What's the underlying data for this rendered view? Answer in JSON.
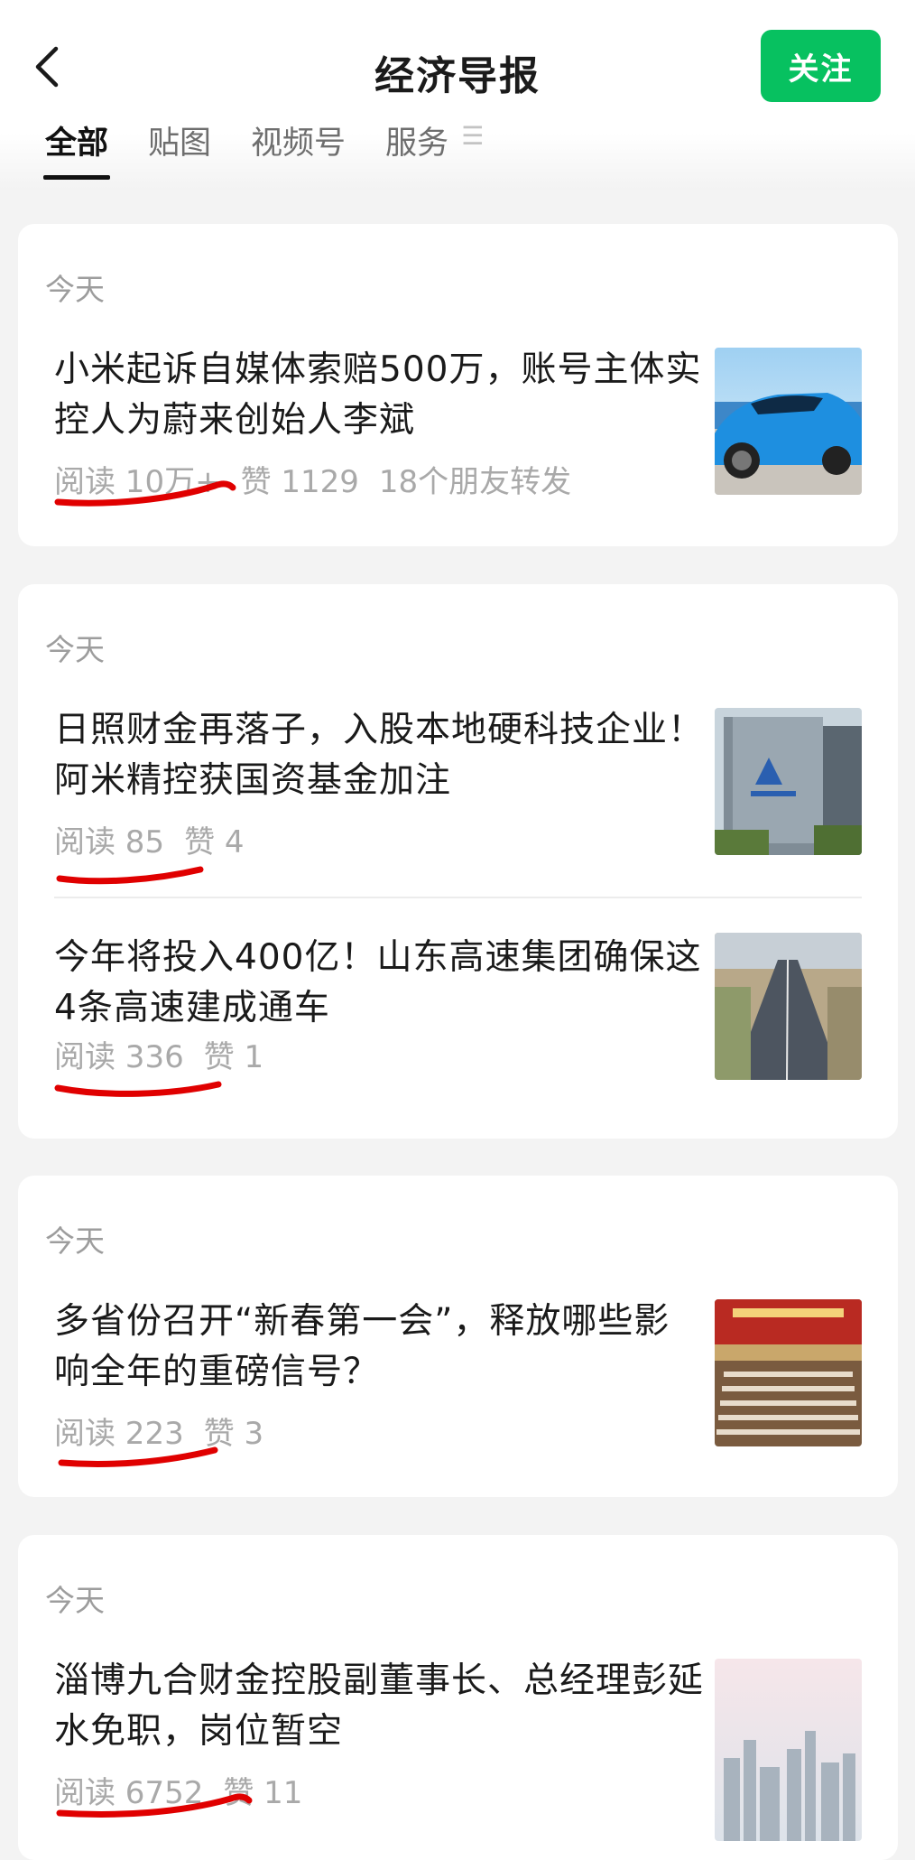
{
  "header": {
    "title": "经济导报",
    "follow_label": "关注"
  },
  "tabs": [
    {
      "label": "全部",
      "active": true
    },
    {
      "label": "贴图"
    },
    {
      "label": "视频号"
    },
    {
      "label": "服务"
    }
  ],
  "tab_more_glyph": "☰",
  "accent_color": "#07c160",
  "annotation_color": "#e00000",
  "cards": [
    {
      "date": "今天",
      "articles": [
        {
          "headline": "小米起诉自媒体索赔500万，账号主体实控人为蔚来创始人李斌",
          "reads": "阅读 10万+",
          "likes": "赞 1129",
          "shares": "18个朋友转发",
          "thumb": "blue-sports-car-image"
        }
      ]
    },
    {
      "date": "今天",
      "articles": [
        {
          "headline": "日照财金再落子，入股本地硬科技企业！阿米精控获国资基金加注",
          "reads": "阅读 85",
          "likes": "赞 4",
          "thumb": "office-building-image"
        },
        {
          "headline": "今年将投入400亿！山东高速集团确保这4条高速建成通车",
          "reads": "阅读 336",
          "likes": "赞 1",
          "thumb": "highway-aerial-image"
        }
      ]
    },
    {
      "date": "今天",
      "articles": [
        {
          "headline": "多省份召开“新春第一会”，释放哪些影响全年的重磅信号？",
          "reads": "阅读 223",
          "likes": "赞 3",
          "thumb": "conference-hall-image"
        }
      ]
    },
    {
      "date": "今天",
      "articles": [
        {
          "headline": "淄博九合财金控股副董事长、总经理彭延水免职，岗位暂空",
          "reads": "阅读 6752",
          "likes": "赞 11",
          "thumb": "city-skyline-image"
        }
      ]
    }
  ]
}
